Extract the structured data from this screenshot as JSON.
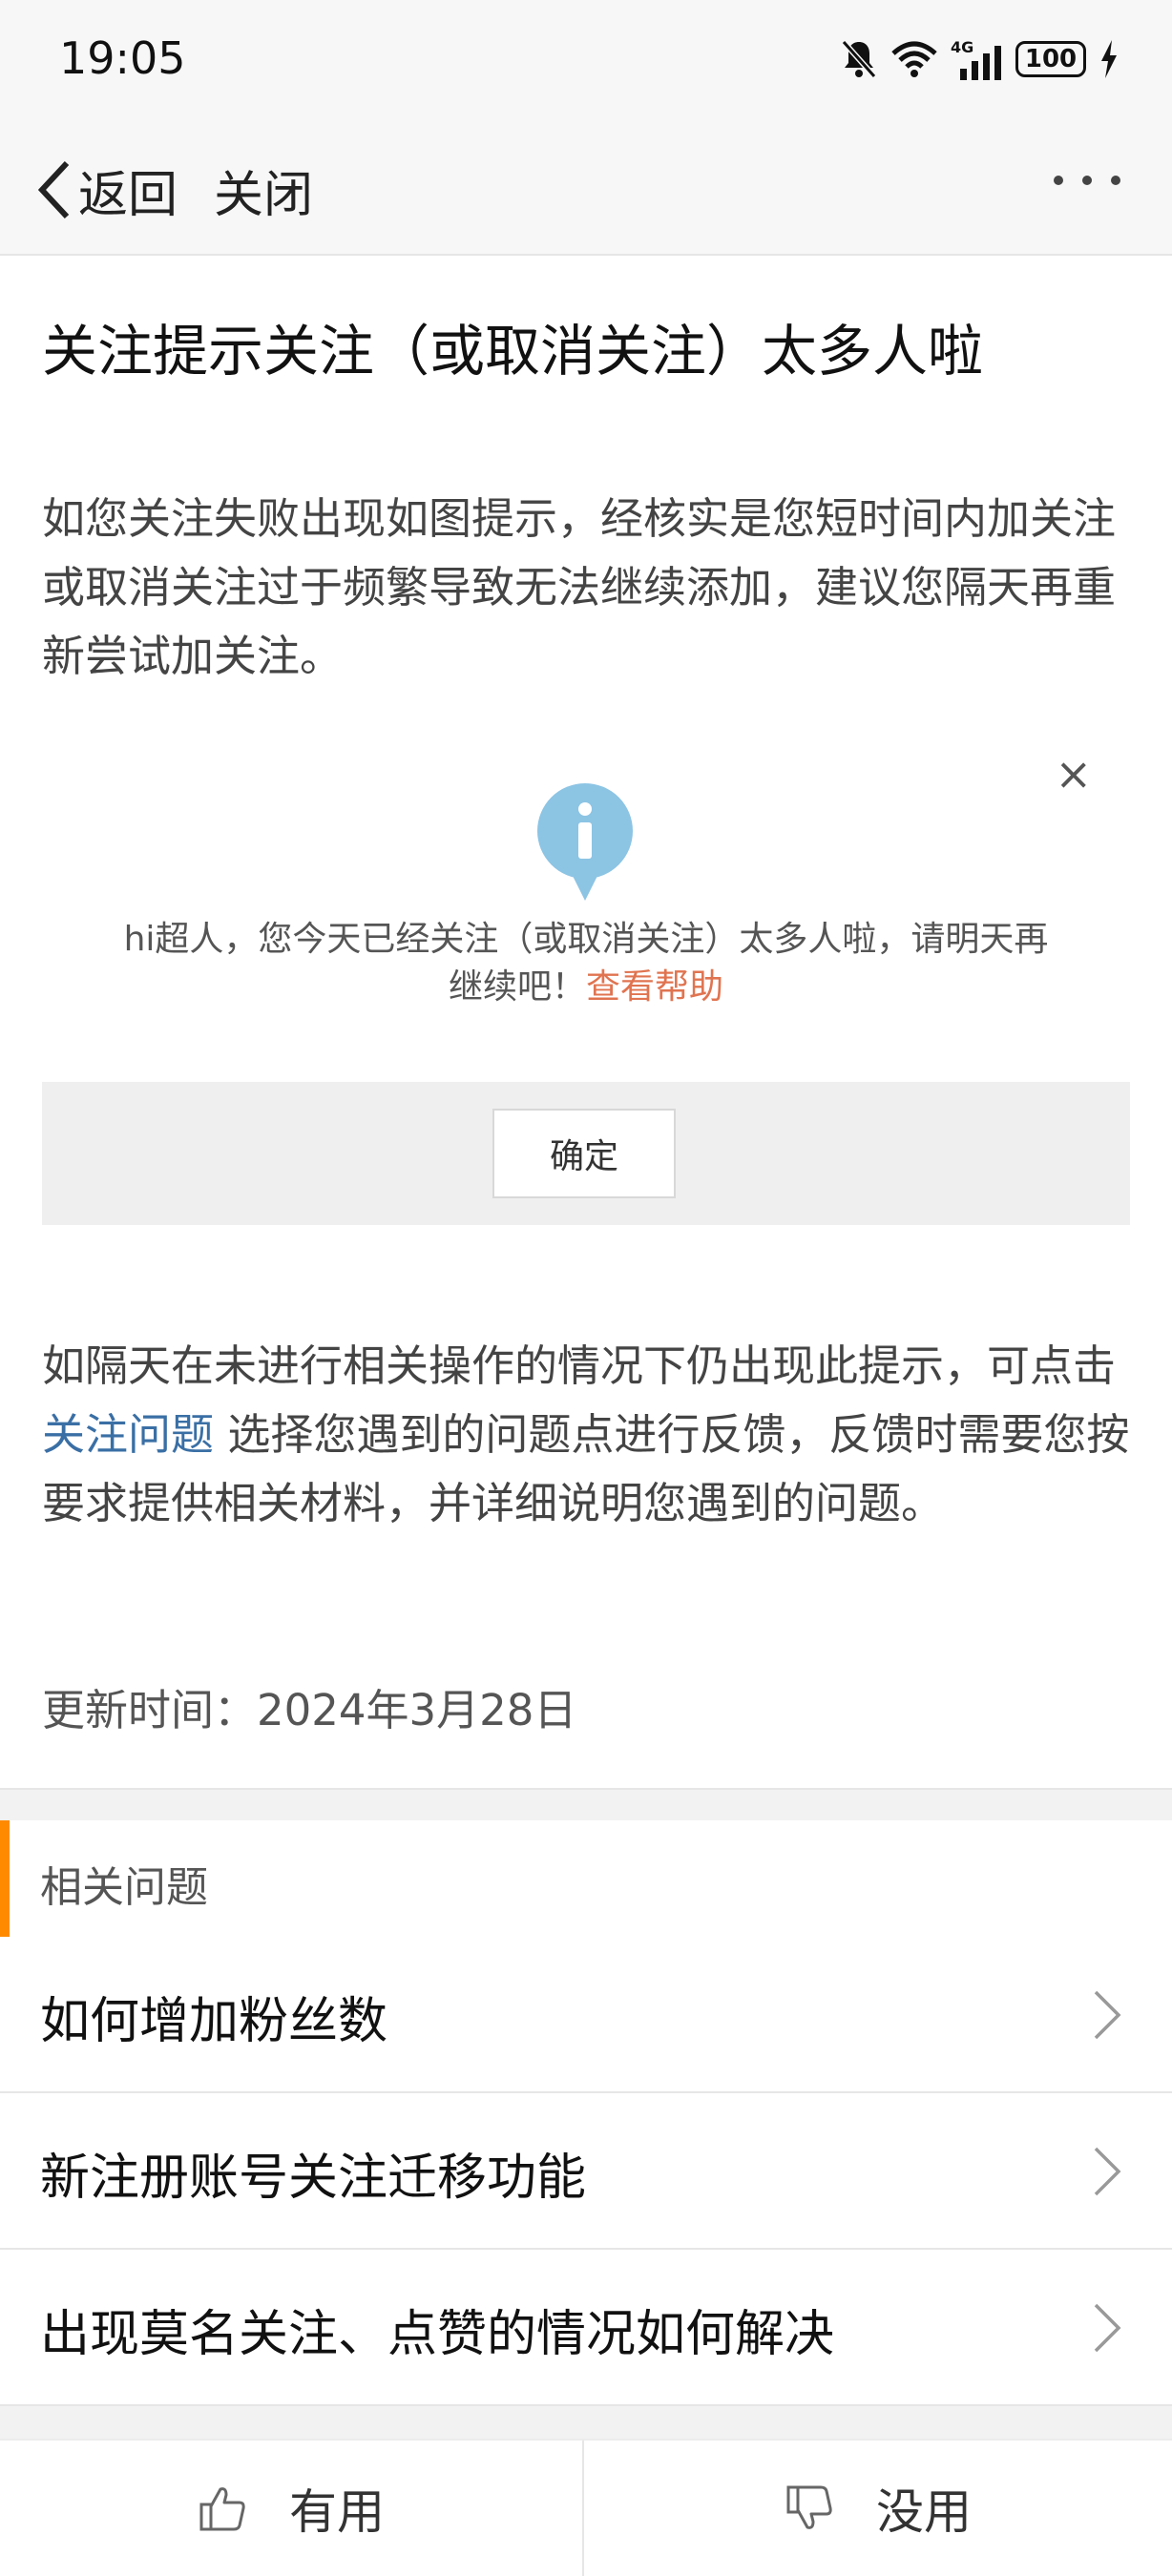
{
  "status_bar": {
    "time": "19:05",
    "battery": "100",
    "network": "4G",
    "icons": [
      "mute-bell-icon",
      "wifi-icon",
      "signal-icon",
      "battery-icon",
      "charging-icon"
    ]
  },
  "nav": {
    "back_label": "返回",
    "close_label": "关闭"
  },
  "article": {
    "title": "关注提示关注（或取消关注）太多人啦",
    "intro": "如您关注失败出现如图提示，经核实是您短时间内加关注或取消关注过于频繁导致无法继续添加，建议您隔天再重新尝试加关注。",
    "dialog": {
      "message": "hi超人，您今天已经关注（或取消关注）太多人啦，请明天再继续吧！",
      "help_link": "查看帮助",
      "ok_label": "确定",
      "close_symbol": "×"
    },
    "followup_before": "如隔天在未进行相关操作的情况下仍出现此提示，可点击 ",
    "followup_link": "关注问题",
    "followup_after": " 选择您遇到的问题点进行反馈，反馈时需要您按要求提供相关材料，并详细说明您遇到的问题。",
    "updated": "更新时间：2024年3月28日"
  },
  "related": {
    "title": "相关问题",
    "items": [
      {
        "label": "如何增加粉丝数"
      },
      {
        "label": "新注册账号关注迁移功能"
      },
      {
        "label": "出现莫名关注、点赞的情况如何解决"
      }
    ]
  },
  "feedback": {
    "useful_label": "有用",
    "useless_label": "没用"
  },
  "colors": {
    "accent_orange": "#ff8a00",
    "link_blue": "#3a6fa5",
    "help_link_orange": "#e07450",
    "info_badge_blue": "#8cc4e4"
  }
}
